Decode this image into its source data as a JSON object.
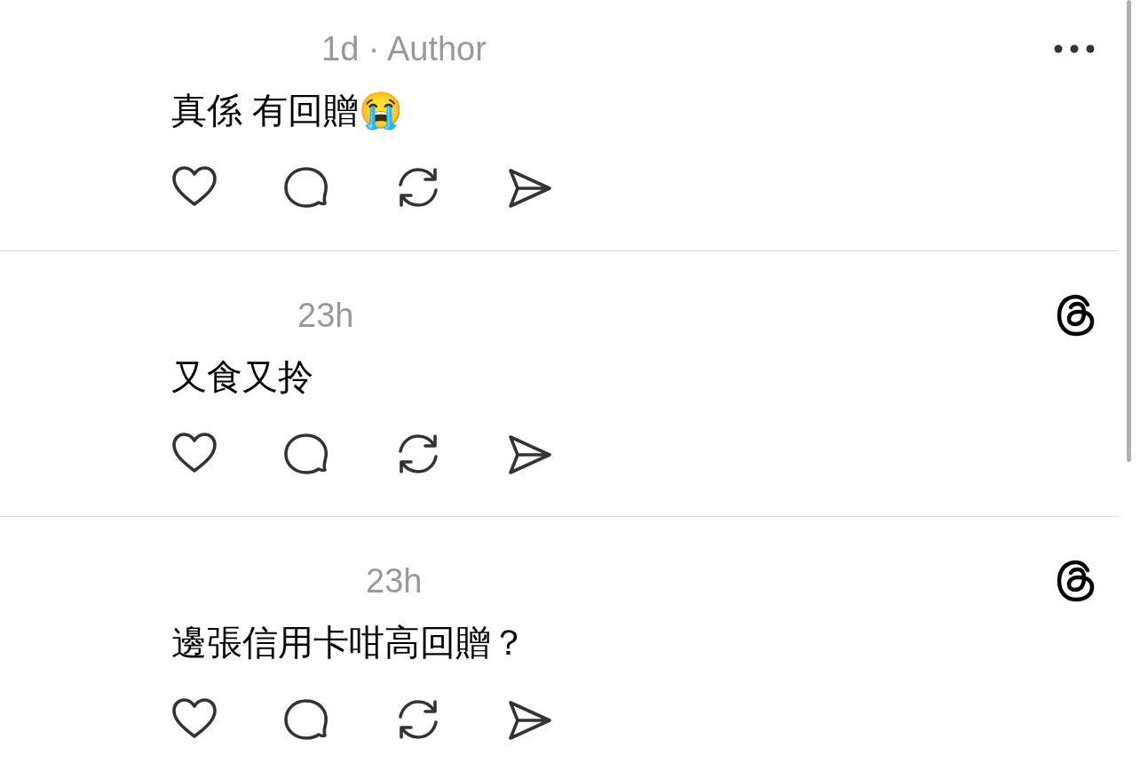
{
  "replies": [
    {
      "meta": "1d · Author",
      "text": "真係 有回贈😭",
      "corner_icon": {
        "kind": "more"
      }
    },
    {
      "meta": "23h",
      "text": "又食又拎",
      "corner_icon": {
        "kind": "logo"
      }
    },
    {
      "meta": "23h",
      "text": "邊張信用卡咁高回贈？",
      "corner_icon": {
        "kind": "logo"
      }
    }
  ]
}
